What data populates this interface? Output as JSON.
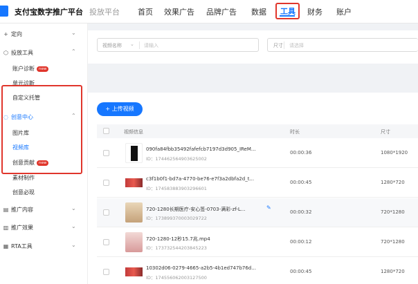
{
  "header": {
    "brand": "支付宝数字推广平台",
    "subbrand": "投放平台",
    "nav": [
      "首页",
      "效果广告",
      "品牌广告",
      "数据",
      "工具",
      "财务",
      "账户"
    ],
    "active_nav": "工具"
  },
  "sidebar": {
    "targeting": "定向",
    "delivery_tools": "投放工具",
    "account_diag": "账户诊断",
    "unit_diag": "单元诊断",
    "custom_hosting": "自定义托管",
    "creative_center": "创意中心",
    "image_lib": "图片库",
    "video_lib": "视频库",
    "creative_contrib": "创意贡献",
    "material_make": "素材制作",
    "creative_must": "创意必现",
    "promo_content": "推广内容",
    "promo_effect": "推广效果",
    "rta_tools": "RTA工具",
    "new_badge": "new"
  },
  "filter": {
    "video_name_label": "视频名称",
    "video_name_placeholder": "请输入",
    "size_label": "尺寸",
    "size_placeholder": "请选择"
  },
  "upload_button": "上传视频",
  "table": {
    "headers": {
      "info": "视频信息",
      "duration": "时长",
      "size": "尺寸"
    },
    "rows": [
      {
        "name": "090fa84fbb35492fafefcb7197d3d905_IReM...",
        "id": "ID：174462564903625002",
        "duration": "00:00:36",
        "size": "1080*1920",
        "thumb": "dark"
      },
      {
        "name": "c3f1b0f1-bd7a-4770-be76-e7f3a2dbfa2d_t...",
        "id": "ID：174583883903296601",
        "duration": "00:00:45",
        "size": "1280*720",
        "thumb": "red"
      },
      {
        "name": "720-1280长期医疗-安心签-0703-满彩-zf-L...",
        "id": "ID：173899370003029722",
        "duration": "00:00:32",
        "size": "720*1280",
        "thumb": "light"
      },
      {
        "name": "720-1280-12秒15.7兆.mp4",
        "id": "ID：173732544203845223",
        "duration": "00:00:12",
        "size": "720*1280",
        "thumb": "pink"
      },
      {
        "name": "10302d06-0279-4665-a2b5-4b1ed747b76d...",
        "id": "ID：174556062003127500",
        "duration": "00:00:45",
        "size": "1280*720",
        "thumb": "red"
      }
    ]
  },
  "colors": {
    "primary": "#1677ff",
    "highlight": "#e0352b",
    "badge": "#e0352b"
  }
}
